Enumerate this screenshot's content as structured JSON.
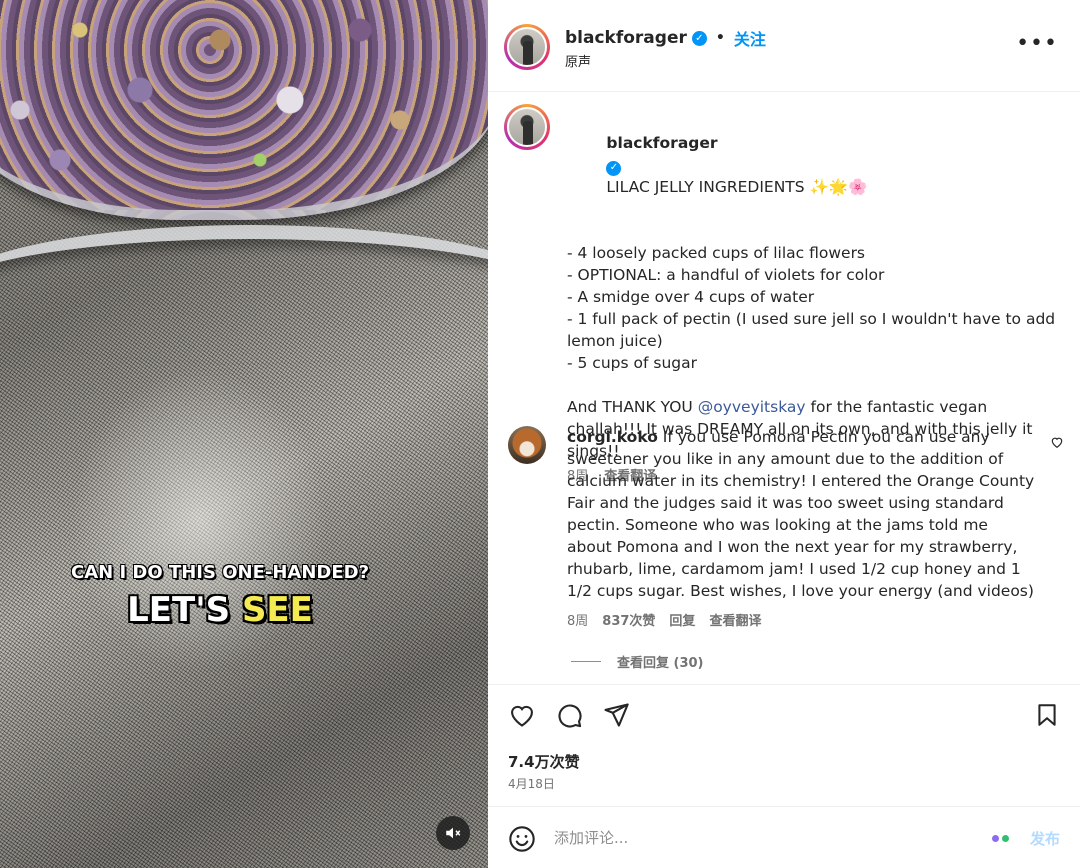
{
  "video": {
    "overlay_line1": "CAN I DO THIS ONE-HANDED?",
    "overlay_line2_white": "LET'S",
    "overlay_line2_yellow": "SEE",
    "mute_icon": "muted-speaker-icon"
  },
  "header": {
    "username": "blackforager",
    "verified": true,
    "separator": "•",
    "follow_label": "关注",
    "subtitle": "原声",
    "more_icon": "more-horizontal-icon"
  },
  "caption": {
    "username": "blackforager",
    "title": "LILAC JELLY INGREDIENTS ✨🌟🌸",
    "lines": [
      "- 4 loosely packed cups of lilac flowers",
      "- OPTIONAL: a handful of violets for color",
      "- A smidge over 4 cups of water",
      "- 1 full pack of pectin (I used sure jell so I wouldn't have to add lemon juice)",
      "- 5 cups of sugar"
    ],
    "thanks_prefix": "And THANK YOU ",
    "mention": "@oyveyitskay",
    "thanks_suffix": " for the fantastic vegan challah!!! It was DREAMY all on its own, and with this jelly it sings!!",
    "time": "8周",
    "translate": "查看翻译"
  },
  "comment": {
    "username": "corgi.koko",
    "text": "If you use Pomona Pectin you can use any sweetener you like in any amount due to the addition of calcium water in its chemistry! I entered the Orange County Fair and the judges said it was too sweet using standard pectin. Someone who was looking at the jams told me about Pomona and I won the next year for my strawberry, rhubarb, lime, cardamom jam! I used 1/2 cup honey and 1 1/2 cups sugar. Best wishes, I love your energy (and videos)",
    "time": "8周",
    "likes": "837次赞",
    "reply": "回复",
    "translate": "查看翻译",
    "view_replies": "查看回复 (30)",
    "heart_icon": "heart-outline-icon"
  },
  "actions": {
    "like_icon": "heart-outline-icon",
    "comment_icon": "comment-bubble-icon",
    "share_icon": "send-paper-plane-icon",
    "save_icon": "bookmark-icon",
    "likes_count": "7.4万次赞",
    "date": "4月18日"
  },
  "comment_box": {
    "emoji_icon": "smiley-face-icon",
    "placeholder": "添加评论...",
    "post_label": "发布",
    "colors": {
      "post_disabled": "#b3dbff",
      "dot1": "#8b6cf0",
      "dot2": "#2fbf71"
    }
  }
}
